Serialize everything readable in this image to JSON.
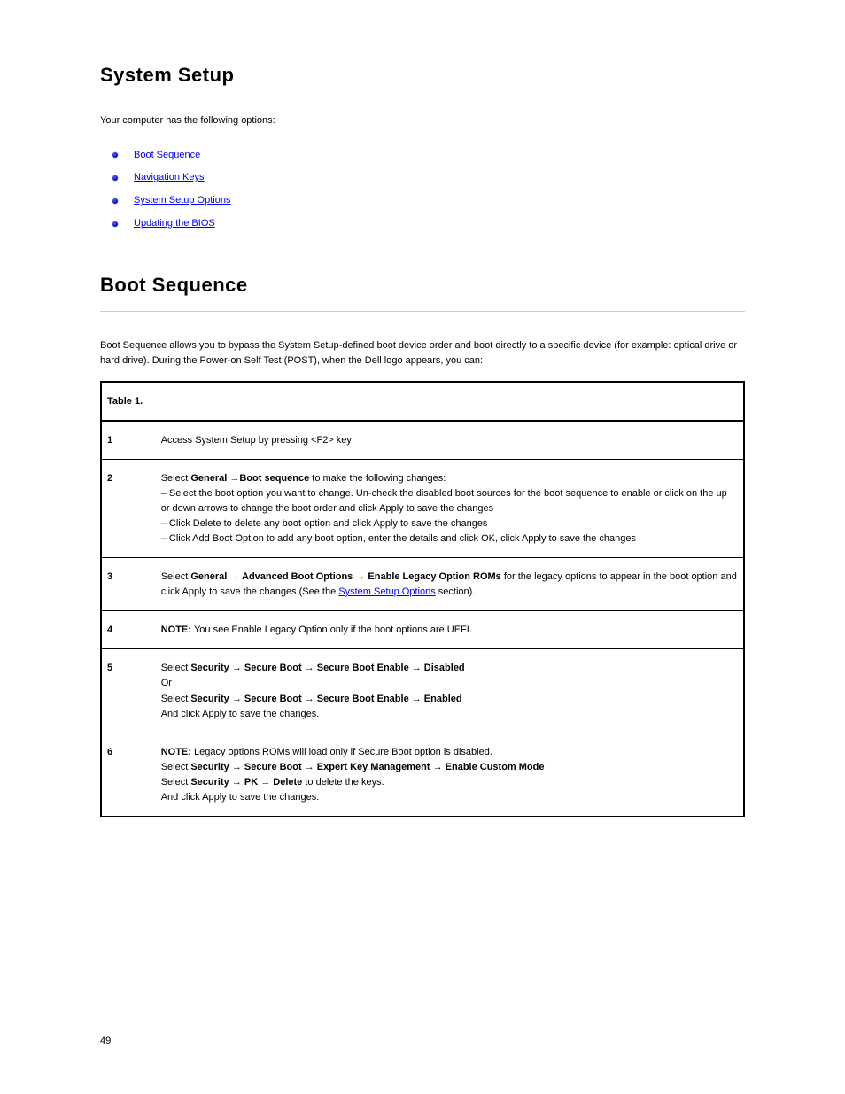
{
  "page_title": "System Setup",
  "intro": "Your computer has the following options:",
  "bullets": [
    "Boot Sequence",
    "Navigation Keys",
    "System Setup Options",
    "Updating the BIOS"
  ],
  "section": {
    "title": "Boot Sequence",
    "p1": "Boot Sequence allows you to bypass the System Setup-defined boot device order and boot directly to a specific device (for example: optical drive or hard drive). During the Power-on Self Test (POST), when the Dell logo appears, you can:",
    "table_caption": "Table 1. ",
    "rows": [
      {
        "label": "1",
        "text": "Access System Setup by pressing <F2> key"
      },
      {
        "label": "2",
        "text_before": "Select ",
        "bold1": "General ",
        "arrow1": "→",
        "text_mid": " ",
        "bold2": "Boot sequence",
        "text_after": " to make the following changes:",
        "sub": [
          "– Select the boot option you want to change. Un-check the disabled boot sources for the boot sequence to enable or click on the up or down arrows to change the boot order and click Apply to save the changes",
          "– Click Delete to delete any boot option and click Apply to save the changes",
          "– Click Add Boot Option to add any boot option, enter the details and click OK, click Apply to save the changes"
        ]
      },
      {
        "label": "3",
        "text_before": "Select ",
        "bold1": "General ",
        "arrow1": "→",
        "bold2": " Advanced Boot Options ",
        "arrow2": "→",
        "bold3": " Enable Legacy Option ROMs",
        "text_after": " for the legacy options to appear in the boot option and click Apply to save the changes (See the ",
        "link": "System Setup Options",
        "after_link": " section)."
      },
      {
        "label": "4",
        "text_before": "",
        "bold1": "NOTE: ",
        "text_after": "You see Enable Legacy Option only if the boot options are UEFI."
      },
      {
        "label": "5",
        "text_before": "Select ",
        "bold1": "Security ",
        "arrow1": "→",
        "bold2": " Secure Boot ",
        "arrow2": "→",
        "bold3": " Secure Boot Enable ",
        "arrow3": "→",
        "bold4": " Disabled",
        "text_after": "",
        "sub": [
          "Or"
        ],
        "line2_before": "Select ",
        "l2_bold1": "Security ",
        "l2_arrow1": "→",
        "l2_bold2": " Secure Boot ",
        "l2_arrow2": "→",
        "l2_bold3": " Secure Boot Enable ",
        "l2_arrow3": "→",
        "l2_bold4": " Enabled",
        "l2_after": "",
        "tail": "And click Apply to save the changes."
      },
      {
        "label": "6",
        "text_before": "",
        "bold1": "NOTE: ",
        "text_after": "Legacy options ROMs will load only if Secure Boot option is disabled.",
        "line2_before": "Select ",
        "l2_bold1": "Security ",
        "l2_arrow1": "→",
        "l2_bold2": " Secure Boot ",
        "l2_arrow2": "→",
        "l2_bold3": " Expert Key Management ",
        "l2_arrow3": "→",
        "l2_bold4": " Enable Custom Mode",
        "l2_after": "",
        "line3_before": "Select ",
        "l3_bold1": "Security ",
        "l3_arrow1": "→",
        "l3_bold2": " PK ",
        "l3_arrow2": "→",
        "l3_bold3": " Delete",
        "l3_after": " to delete the keys.",
        "tail": "And click Apply to save the changes."
      }
    ]
  },
  "footer": "49"
}
